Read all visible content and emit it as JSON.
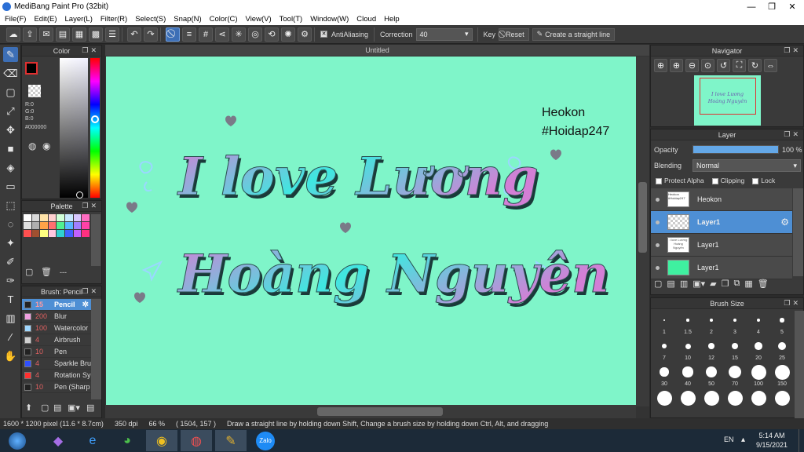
{
  "window": {
    "title": "MediBang Paint Pro (32bit)",
    "minimize": "—",
    "restore": "❐",
    "close": "✕"
  },
  "menu": [
    "File(F)",
    "Edit(E)",
    "Layer(L)",
    "Filter(R)",
    "Select(S)",
    "Snap(N)",
    "Color(C)",
    "View(V)",
    "Tool(T)",
    "Window(W)",
    "Cloud",
    "Help"
  ],
  "toolbar": {
    "antialiasing_label": "AntiAliasing",
    "correction_label": "Correction",
    "correction_value": "40",
    "key_label": "Key",
    "reset_label": "Reset",
    "straight_line_label": "Create a straight line"
  },
  "color_panel": {
    "title": "Color",
    "r": "R:0",
    "g": "G:0",
    "b": "B:0",
    "hex": "#000000"
  },
  "palette_panel": {
    "title": "Palette",
    "swatches": [
      "#ffffff",
      "#d8d8d8",
      "#ffe3a8",
      "#ffd0d0",
      "#d0ffd8",
      "#c8e8ff",
      "#d8c8ff",
      "#ff6cc2",
      "#e0e0e0",
      "#b0b0b0",
      "#ffa348",
      "#ff7070",
      "#50f090",
      "#58b8ff",
      "#a080ff",
      "#ff40a8",
      "#ff5050",
      "#a05030",
      "#ffff80",
      "#ffc8e0",
      "#30d0d0",
      "#4060ff",
      "#c060ff",
      "#ff3080"
    ],
    "dash": "---"
  },
  "brush_panel": {
    "title": "Brush: Pencil",
    "items": [
      {
        "size": "15",
        "name": "Pencil",
        "color": "#222222"
      },
      {
        "size": "200",
        "name": "Blur",
        "color": "#f0a0e0"
      },
      {
        "size": "100",
        "name": "Watercolor",
        "color": "#a0d8ff"
      },
      {
        "size": "4",
        "name": "Airbrush",
        "color": "#d0d0d0"
      },
      {
        "size": "10",
        "name": "Pen",
        "color": "#222222"
      },
      {
        "size": "4",
        "name": "Sparkle Bru",
        "color": "#3050ff"
      },
      {
        "size": "4",
        "name": "Rotation Sy",
        "color": "#ff3030"
      },
      {
        "size": "10",
        "name": "Pen (Sharp",
        "color": "#222222"
      }
    ]
  },
  "canvas": {
    "tab_title": "Untitled",
    "signature_line1": "Heokon",
    "signature_line2": "#Hoidap247",
    "text_line1": "I love Lương",
    "text_line2": "Hoàng Nguyên"
  },
  "navigator": {
    "title": "Navigator",
    "preview_line1": "I love Lương",
    "preview_line2": "Hoàng Nguyên"
  },
  "layer_panel": {
    "title": "Layer",
    "opacity_label": "Opacity",
    "opacity_value": "100 %",
    "opacity_level": 1.0,
    "blending_label": "Blending",
    "blending_value": "Normal",
    "protect_alpha": "Protect Alpha",
    "clipping": "Clipping",
    "lock": "Lock",
    "layers": [
      {
        "name": "Heokon",
        "thumb_text": "Heokon #Hoidap247"
      },
      {
        "name": "Layer1",
        "thumb_text": ""
      },
      {
        "name": "Layer1",
        "thumb_text": "I love Lương Hoàng Nguyên"
      },
      {
        "name": "Layer1",
        "thumb_text": ""
      }
    ]
  },
  "brush_size_panel": {
    "title": "Brush Size",
    "sizes": [
      "1",
      "1.5",
      "2",
      "3",
      "4",
      "5",
      "7",
      "10",
      "12",
      "15",
      "20",
      "25",
      "30",
      "40",
      "50",
      "70",
      "100",
      "150"
    ]
  },
  "status_bar": {
    "dimensions": "1600 * 1200 pixel",
    "physical": "(11.6 * 8.7cm)",
    "dpi": "350 dpi",
    "zoom": "66 %",
    "coords": "( 1504, 157 )",
    "hint": "Draw a straight line by holding down Shift, Change a brush size by holding down Ctrl, Alt, and dragging"
  },
  "taskbar": {
    "lang": "EN",
    "time": "5:14 AM",
    "date": "9/15/2021",
    "zalo_label": "Zalo"
  },
  "colors": {
    "accent": "#3d6fb6",
    "canvas_bg": "#7ff5c9",
    "lettering_cyan": "#3ee8e0",
    "lettering_pink": "#d37fd6"
  }
}
